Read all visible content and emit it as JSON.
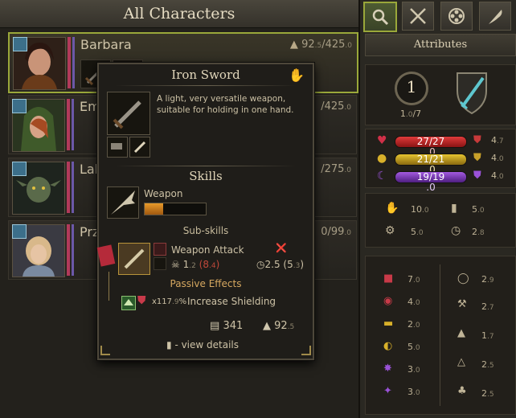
{
  "list": {
    "title": "All Characters",
    "characters": [
      {
        "name": "Barbara",
        "weight_int": "92",
        "weight_dec": ".5",
        "capacity": "/425",
        "capacity_dec": ".0"
      },
      {
        "name": "Em",
        "weight_int": "",
        "weight_dec": "",
        "capacity": "/425",
        "capacity_dec": ".0"
      },
      {
        "name": "Lah",
        "weight_int": "",
        "weight_dec": "",
        "capacity": "/275",
        "capacity_dec": ".0"
      },
      {
        "name": "Prz",
        "weight_int": "",
        "weight_dec": "",
        "capacity": "0/99",
        "capacity_dec": ".0"
      }
    ]
  },
  "tabs": [
    "search-icon",
    "crossed-swords-icon",
    "shield-emblem-icon",
    "feather-icon"
  ],
  "attributes": {
    "title": "Attributes",
    "level": "1",
    "xp": "1",
    "xp_dec": ".0",
    "xp_max": "/7",
    "bars": [
      {
        "icon": "heart-icon",
        "text": "27/27",
        "text_dec": ".0",
        "color": "#c8232a",
        "icon2": "shield-red-icon",
        "val": "4",
        "val_dec": ".7"
      },
      {
        "icon": "coin-icon",
        "text": "21/21",
        "text_dec": ".0",
        "color": "#c9a51c",
        "icon2": "shield-gold-icon",
        "val": "4",
        "val_dec": ".0"
      },
      {
        "icon": "moon-icon",
        "text": "19/19",
        "text_dec": ".0",
        "color": "#8a3fc4",
        "icon2": "shield-purple-icon",
        "val": "4",
        "val_dec": ".0"
      }
    ],
    "mid": [
      {
        "icon": "thumb-up-icon",
        "val": "10",
        "val_dec": ".0"
      },
      {
        "icon": "boot-icon",
        "val": "5",
        "val_dec": ".0"
      },
      {
        "icon": "gears-icon",
        "val": "5",
        "val_dec": ".0"
      },
      {
        "icon": "clock-icon",
        "val": "2",
        "val_dec": ".8"
      }
    ],
    "left_col": [
      {
        "icon": "muscle-icon",
        "val": "7",
        "val_dec": ".0"
      },
      {
        "icon": "eye-icon",
        "val": "4",
        "val_dec": ".0"
      },
      {
        "icon": "book-icon",
        "val": "2",
        "val_dec": ".0"
      },
      {
        "icon": "owl-icon",
        "val": "5",
        "val_dec": ".0"
      },
      {
        "icon": "star-burst-icon",
        "val": "3",
        "val_dec": ".0"
      },
      {
        "icon": "comet-icon",
        "val": "3",
        "val_dec": ".0"
      }
    ],
    "right_col": [
      {
        "icon": "basket-icon",
        "val": "2",
        "val_dec": ".9"
      },
      {
        "icon": "hammer-icon",
        "val": "2",
        "val_dec": ".7"
      },
      {
        "icon": "flask-icon",
        "val": "1",
        "val_dec": ".7"
      },
      {
        "icon": "candle-icon",
        "val": "2",
        "val_dec": ".5"
      },
      {
        "icon": "clover-icon",
        "val": "2",
        "val_dec": ".5"
      }
    ]
  },
  "tooltip": {
    "title": "Iron Sword",
    "description": "A light, very versatile weapon, suitable for holding in one hand.",
    "skills_title": "Skills",
    "skill_name": "Weapon",
    "skill_progress": 0.3,
    "subskills_title": "Sub-skills",
    "subskill_name": "Weapon Attack",
    "kill_int": "1",
    "kill_dec": ".2",
    "kill_paren_open": "(",
    "kill_paren_int": "8",
    "kill_paren_dec": ".4",
    "kill_paren_close": ")",
    "time_int": "2",
    "time_dec": ".5",
    "time_paren_open": "(",
    "time_paren_int": "5",
    "time_paren_dec": ".3",
    "time_paren_close": ")",
    "passive_title": "Passive Effects",
    "passive_mult": "x117",
    "passive_mult_dec": ".9",
    "passive_pct": "%",
    "passive_name": "Increase Shielding",
    "value": "341",
    "weight_int": "92",
    "weight_dec": ".5",
    "hint": "- view details"
  }
}
